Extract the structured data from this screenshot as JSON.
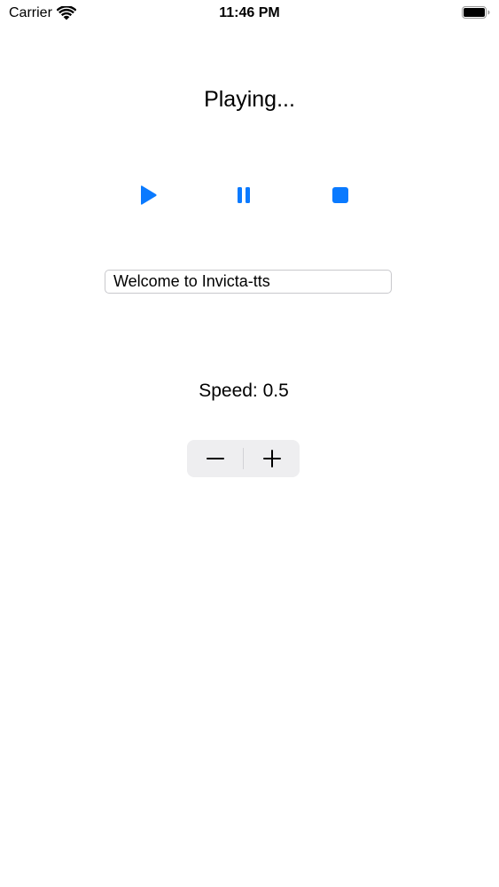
{
  "status_bar": {
    "carrier": "Carrier",
    "time": "11:46 PM"
  },
  "player": {
    "status_text": "Playing..."
  },
  "controls": {
    "play_icon": "play-icon",
    "pause_icon": "pause-icon",
    "stop_icon": "stop-icon"
  },
  "text_input": {
    "value": "Welcome to Invicta-tts"
  },
  "speed": {
    "label": "Speed: 0.5"
  },
  "stepper": {
    "minus_icon": "minus-icon",
    "plus_icon": "plus-icon"
  },
  "colors": {
    "accent": "#0a7aff",
    "stepper_background": "#eeeef0"
  }
}
